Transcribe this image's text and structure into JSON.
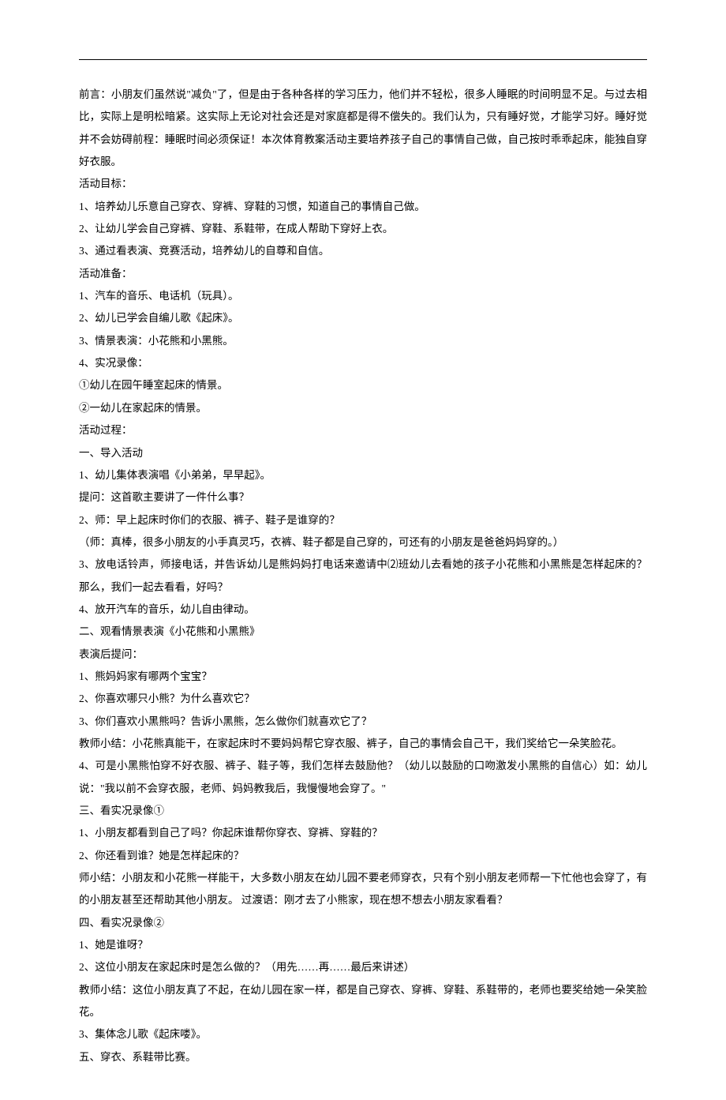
{
  "lines": [
    "前言：小朋友们虽然说\"减负\"了，但是由于各种各样的学习压力，他们并不轻松，很多人睡眠的时间明显不足。与过去相比，实际上是明松暗紧。这实际上无论对社会还是对家庭都是得不偿失的。我们认为，只有睡好觉，才能学习好。睡好觉并不会妨碍前程：睡眠时间必须保证！本次体育教案活动主要培养孩子自己的事情自己做，自己按时乖乖起床，能独自穿好衣服。",
    "活动目标：",
    "1、培养幼儿乐意自己穿衣、穿裤、穿鞋的习惯，知道自己的事情自己做。",
    "2、让幼儿学会自己穿裤、穿鞋、系鞋带，在成人帮助下穿好上衣。",
    "3、通过看表演、竞赛活动，培养幼儿的自尊和自信。",
    "活动准备：",
    "1、汽车的音乐、电话机（玩具）。",
    "2、幼儿已学会自编儿歌《起床》。",
    "3、情景表演：小花熊和小黑熊。",
    "4、实况录像：",
    "①幼儿在园午睡室起床的情景。",
    "②一幼儿在家起床的情景。",
    "活动过程：",
    "一、导入活动",
    "1、幼儿集体表演唱《小弟弟，早早起》。",
    "提问：这首歌主要讲了一件什么事？",
    "2、师：早上起床时你们的衣服、裤子、鞋子是谁穿的？",
    "（师：真棒，很多小朋友的小手真灵巧，衣裤、鞋子都是自己穿的，可还有的小朋友是爸爸妈妈穿的。）",
    "3、放电话铃声，师接电话，并告诉幼儿是熊妈妈打电话来邀请中⑵班幼儿去看她的孩子小花熊和小黑熊是怎样起床的？那么，我们一起去看看，好吗？",
    "4、放开汽车的音乐，幼儿自由律动。",
    "二、观看情景表演《小花熊和小黑熊》",
    "表演后提问：",
    "1、熊妈妈家有哪两个宝宝？",
    "2、你喜欢哪只小熊？为什么喜欢它？",
    "3、你们喜欢小黑熊吗？告诉小黑熊，怎么做你们就喜欢它了？",
    "教师小结：小花熊真能干，在家起床时不要妈妈帮它穿衣服、裤子，自己的事情会自己干，我们奖给它一朵笑脸花。",
    "4、可是小黑熊怕穿不好衣服、裤子、鞋子等，我们怎样去鼓励他？（幼儿以鼓励的口吻激发小黑熊的自信心）如：幼儿说：\"我以前不会穿衣服，老师、妈妈教我后，我慢慢地会穿了。\"",
    "三、看实况录像①",
    "1、小朋友都看到自己了吗？你起床谁帮你穿衣、穿裤、穿鞋的？",
    "2、你还看到谁？她是怎样起床的？",
    "师小结：小朋友和小花熊一样能干，大多数小朋友在幼儿园不要老师穿衣，只有个别小朋友老师帮一下忙他也会穿了，有的小朋友甚至还帮助其他小朋友。 过渡语：刚才去了小熊家，现在想不想去小朋友家看看？",
    "四、看实况录像②",
    "1、她是谁呀？",
    "2、这位小朋友在家起床时是怎么做的？（用先……再……最后来讲述）",
    "教师小结：这位小朋友真了不起，在幼儿园在家一样，都是自己穿衣、穿裤、穿鞋、系鞋带的，老师也要奖给她一朵笑脸花。",
    "3、集体念儿歌《起床喽》。",
    "五、穿衣、系鞋带比赛。"
  ]
}
